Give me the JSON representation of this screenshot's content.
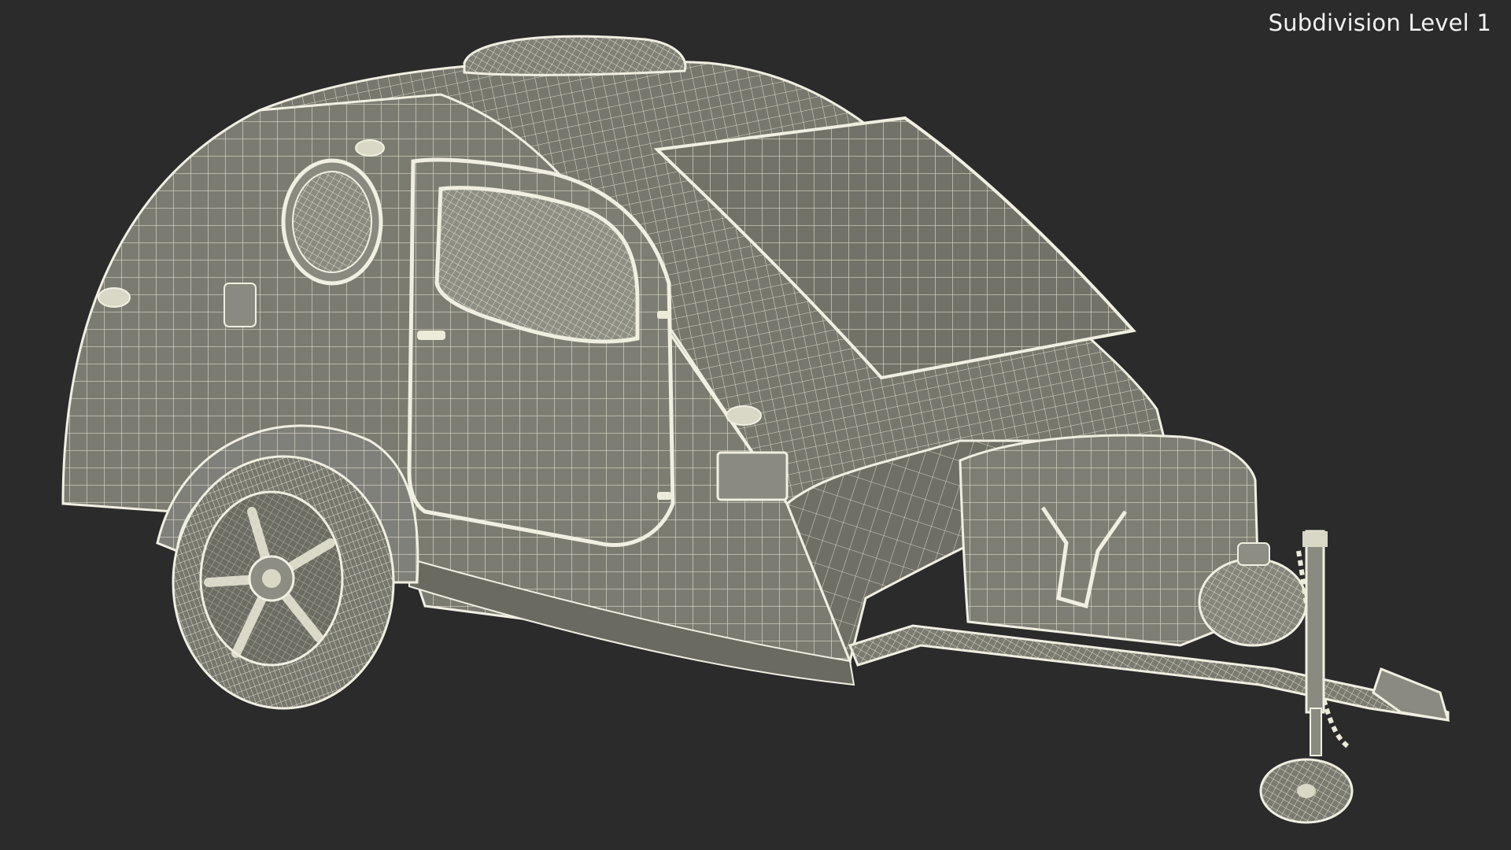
{
  "viewport": {
    "background_color": "#2b2b2b",
    "wire_color": "#f1efe2",
    "surface_color": "#7a7a70"
  },
  "overlay": {
    "subdivision_label": "Subdivision Level 1"
  },
  "model": {
    "icon_name": "teardrop-trailer-wireframe"
  }
}
